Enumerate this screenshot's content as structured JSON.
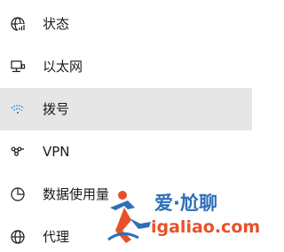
{
  "nav": {
    "items": [
      {
        "label": "状态",
        "icon": "globe-status-icon",
        "selected": false
      },
      {
        "label": "以太网",
        "icon": "ethernet-icon",
        "selected": false
      },
      {
        "label": "拨号",
        "icon": "dialup-icon",
        "selected": true
      },
      {
        "label": "VPN",
        "icon": "vpn-icon",
        "selected": false
      },
      {
        "label": "数据使用量",
        "icon": "data-usage-icon",
        "selected": false
      },
      {
        "label": "代理",
        "icon": "globe-proxy-icon",
        "selected": false
      }
    ]
  },
  "watermark": {
    "text_cn": "爱·尬聊",
    "text_en": "igaliao.com"
  },
  "colors": {
    "selected_background": "#e6e6e6",
    "accent": "#0078d7",
    "watermark_blue": "#2e6fb8",
    "watermark_orange": "#e8502a"
  }
}
